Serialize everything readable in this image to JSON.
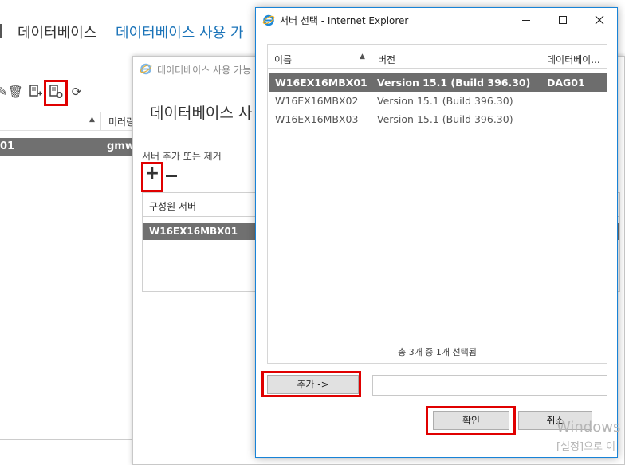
{
  "background": {
    "nav": {
      "tab_databases": "데이터베이스",
      "tab_dag": "데이터베이스 사용 가"
    },
    "table": {
      "col_mirror": "미러링",
      "row_name": "01",
      "row_mirror": "gmw"
    }
  },
  "copy_dialog": {
    "title": "데이터베이스 사용 가능",
    "heading": "데이터베이스 사",
    "add_remove_label": "서버 추가 또는 제거",
    "member_column": "구성원 서버",
    "member_row": "W16EX16MBX01"
  },
  "select_dialog": {
    "title": "서버 선택 - Internet Explorer",
    "columns": {
      "name": "이름",
      "version": "버전",
      "database": "데이터베이..."
    },
    "rows": [
      {
        "name": "W16EX16MBX01",
        "version": "Version 15.1 (Build 396.30)",
        "dag": "DAG01"
      },
      {
        "name": "W16EX16MBX02",
        "version": "Version 15.1 (Build 396.30)",
        "dag": ""
      },
      {
        "name": "W16EX16MBX03",
        "version": "Version 15.1 (Build 396.30)",
        "dag": ""
      }
    ],
    "footer": "총 3개 중 1개 선택됨",
    "add_button": "추가 ->",
    "ok_button": "확인",
    "cancel_button": "취소"
  },
  "watermark": {
    "line1": "Windows",
    "line2": "[설정]으로 이"
  },
  "colors": {
    "highlight": "#e00000",
    "selected_row": "#6d6d6d",
    "link": "#1a73b8",
    "ie_border": "#1883d7"
  }
}
